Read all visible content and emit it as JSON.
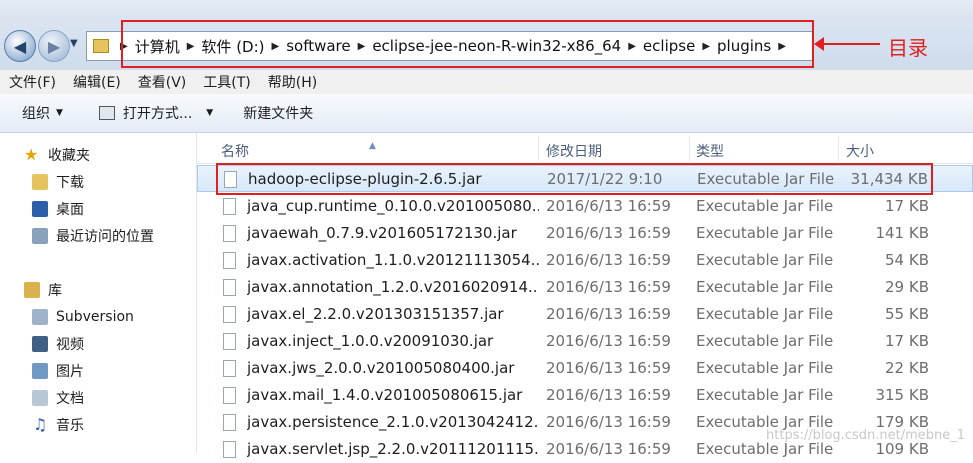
{
  "address_bar": {
    "crumbs": [
      "计算机",
      "软件 (D:)",
      "software",
      "eclipse-jee-neon-R-win32-x86_64",
      "eclipse",
      "plugins"
    ]
  },
  "annotation": {
    "label": "目录",
    "color": "#e02020"
  },
  "menu": [
    "文件(F)",
    "编辑(E)",
    "查看(V)",
    "工具(T)",
    "帮助(H)"
  ],
  "toolbar": {
    "organize": "组织",
    "open_with": "打开方式...",
    "new_folder": "新建文件夹"
  },
  "sidebar": {
    "favorites": {
      "title": "收藏夹",
      "items": [
        "下载",
        "桌面",
        "最近访问的位置"
      ]
    },
    "libraries": {
      "title": "库",
      "items": [
        "Subversion",
        "视频",
        "图片",
        "文档",
        "音乐"
      ]
    }
  },
  "columns": {
    "name": "名称",
    "date": "修改日期",
    "type": "类型",
    "size": "大小"
  },
  "files": [
    {
      "name": "hadoop-eclipse-plugin-2.6.5.jar",
      "date": "2017/1/22 9:10",
      "type": "Executable Jar File",
      "size": "31,434 KB",
      "selected": true
    },
    {
      "name": "java_cup.runtime_0.10.0.v201005080...",
      "date": "2016/6/13 16:59",
      "type": "Executable Jar File",
      "size": "17 KB"
    },
    {
      "name": "javaewah_0.7.9.v201605172130.jar",
      "date": "2016/6/13 16:59",
      "type": "Executable Jar File",
      "size": "141 KB"
    },
    {
      "name": "javax.activation_1.1.0.v20121113054...",
      "date": "2016/6/13 16:59",
      "type": "Executable Jar File",
      "size": "54 KB"
    },
    {
      "name": "javax.annotation_1.2.0.v2016020914...",
      "date": "2016/6/13 16:59",
      "type": "Executable Jar File",
      "size": "29 KB"
    },
    {
      "name": "javax.el_2.2.0.v201303151357.jar",
      "date": "2016/6/13 16:59",
      "type": "Executable Jar File",
      "size": "55 KB"
    },
    {
      "name": "javax.inject_1.0.0.v20091030.jar",
      "date": "2016/6/13 16:59",
      "type": "Executable Jar File",
      "size": "17 KB"
    },
    {
      "name": "javax.jws_2.0.0.v201005080400.jar",
      "date": "2016/6/13 16:59",
      "type": "Executable Jar File",
      "size": "22 KB"
    },
    {
      "name": "javax.mail_1.4.0.v201005080615.jar",
      "date": "2016/6/13 16:59",
      "type": "Executable Jar File",
      "size": "315 KB"
    },
    {
      "name": "javax.persistence_2.1.0.v2013042412...",
      "date": "2016/6/13 16:59",
      "type": "Executable Jar File",
      "size": "179 KB"
    },
    {
      "name": "javax.servlet.jsp_2.2.0.v20111201115...",
      "date": "2016/6/13 16:59",
      "type": "Executable Jar File",
      "size": "109 KB"
    }
  ],
  "watermark": "https://blog.csdn.net/mebne_1"
}
